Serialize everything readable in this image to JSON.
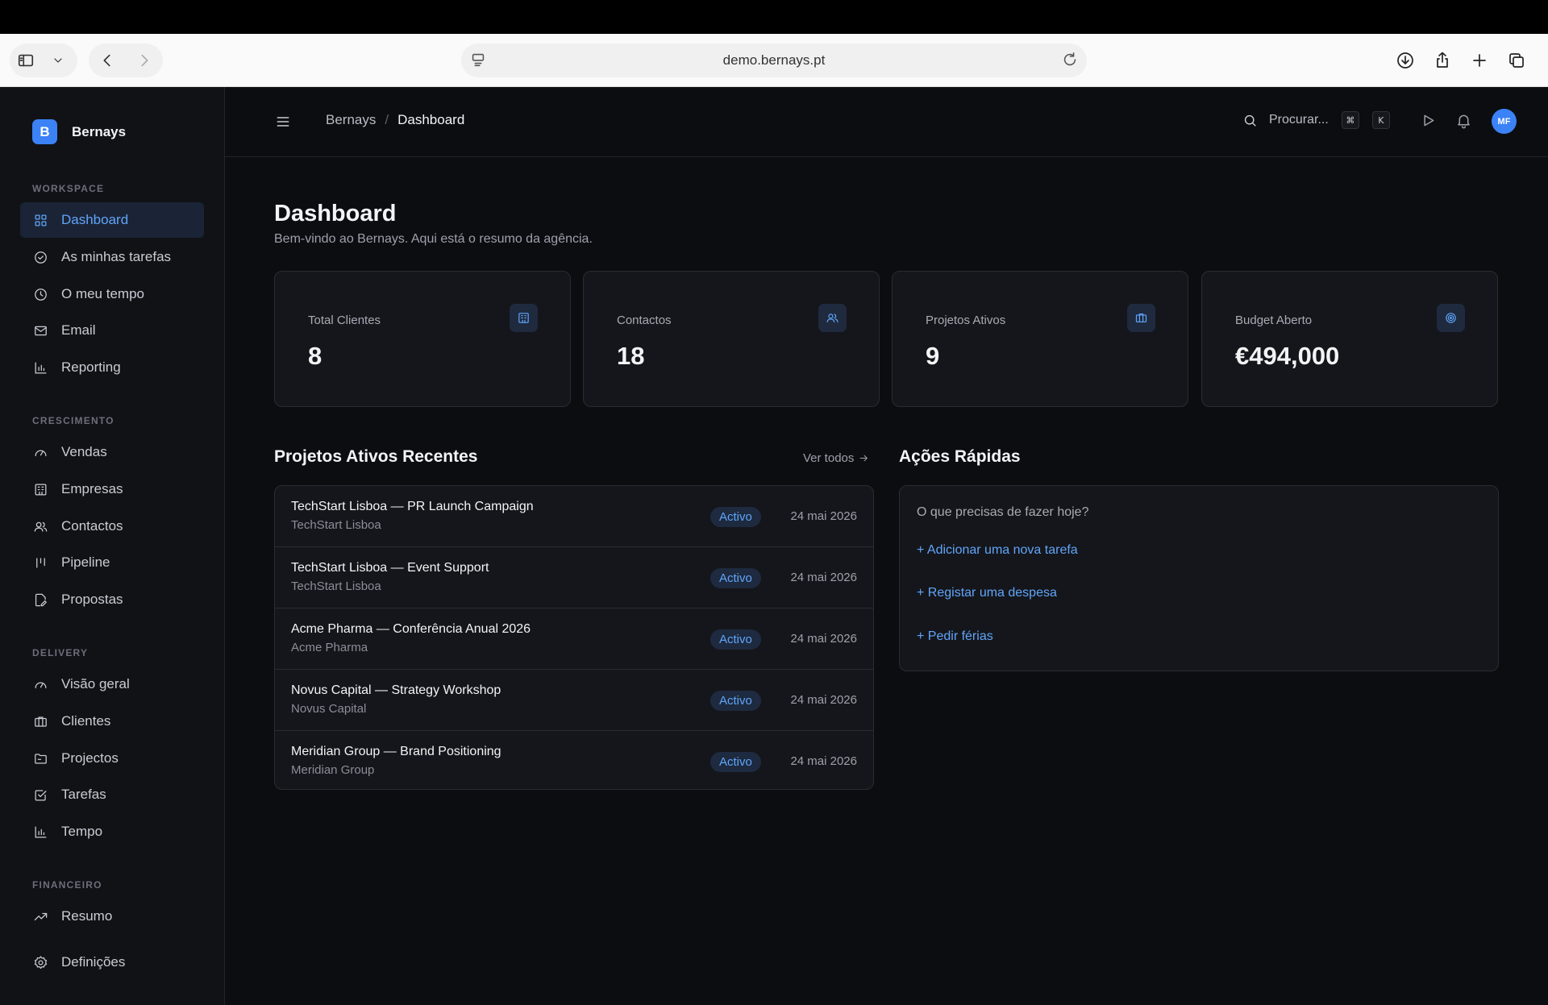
{
  "browser": {
    "url": "demo.bernays.pt"
  },
  "brand": {
    "logo_letter": "B",
    "name": "Bernays"
  },
  "sidebar": {
    "sections": [
      {
        "label": "WORKSPACE",
        "items": [
          {
            "label": "Dashboard",
            "icon": "grid-icon",
            "active": true
          },
          {
            "label": "As minhas tarefas",
            "icon": "check-circle-icon"
          },
          {
            "label": "O meu tempo",
            "icon": "clock-icon"
          },
          {
            "label": "Email",
            "icon": "mail-icon"
          },
          {
            "label": "Reporting",
            "icon": "bar-chart-icon"
          }
        ]
      },
      {
        "label": "CRESCIMENTO",
        "items": [
          {
            "label": "Vendas",
            "icon": "gauge-icon"
          },
          {
            "label": "Empresas",
            "icon": "building-icon"
          },
          {
            "label": "Contactos",
            "icon": "users-icon"
          },
          {
            "label": "Pipeline",
            "icon": "pipeline-icon"
          },
          {
            "label": "Propostas",
            "icon": "file-edit-icon"
          }
        ]
      },
      {
        "label": "DELIVERY",
        "items": [
          {
            "label": "Visão geral",
            "icon": "gauge-icon"
          },
          {
            "label": "Clientes",
            "icon": "briefcase-icon"
          },
          {
            "label": "Projectos",
            "icon": "folder-icon"
          },
          {
            "label": "Tarefas",
            "icon": "checkbox-icon"
          },
          {
            "label": "Tempo",
            "icon": "bar-chart-icon"
          }
        ]
      },
      {
        "label": "FINANCEIRO",
        "items": [
          {
            "label": "Resumo",
            "icon": "trend-up-icon"
          }
        ]
      }
    ],
    "settings_label": "Definições"
  },
  "header": {
    "breadcrumb_root": "Bernays",
    "breadcrumb_separator": "/",
    "breadcrumb_current": "Dashboard",
    "search_placeholder": "Procurar...",
    "shortcut_mod": "⌘",
    "shortcut_key": "K",
    "avatar_initials": "MF"
  },
  "page": {
    "title": "Dashboard",
    "subtitle": "Bem-vindo ao Bernays. Aqui está o resumo da agência."
  },
  "stats": [
    {
      "label": "Total Clientes",
      "value": "8",
      "icon": "building-icon"
    },
    {
      "label": "Contactos",
      "value": "18",
      "icon": "users-icon"
    },
    {
      "label": "Projetos Ativos",
      "value": "9",
      "icon": "briefcase-icon"
    },
    {
      "label": "Budget Aberto",
      "value": "€494,000",
      "icon": "target-icon"
    }
  ],
  "recent_projects": {
    "title": "Projetos Ativos Recentes",
    "see_all": "Ver todos",
    "rows": [
      {
        "name": "TechStart Lisboa — PR Launch Campaign",
        "client": "TechStart Lisboa",
        "status": "Activo",
        "date": "24 mai 2026"
      },
      {
        "name": "TechStart Lisboa — Event Support",
        "client": "TechStart Lisboa",
        "status": "Activo",
        "date": "24 mai 2026"
      },
      {
        "name": "Acme Pharma — Conferência Anual 2026",
        "client": "Acme Pharma",
        "status": "Activo",
        "date": "24 mai 2026"
      },
      {
        "name": "Novus Capital — Strategy Workshop",
        "client": "Novus Capital",
        "status": "Activo",
        "date": "24 mai 2026"
      },
      {
        "name": "Meridian Group — Brand Positioning",
        "client": "Meridian Group",
        "status": "Activo",
        "date": "24 mai 2026"
      }
    ]
  },
  "quick_actions": {
    "title": "Ações Rápidas",
    "prompt": "O que precisas de fazer hoje?",
    "links": [
      "+ Adicionar uma nova tarefa",
      "+ Registar uma despesa",
      "+ Pedir férias"
    ]
  },
  "colors": {
    "accent": "#3b82f6",
    "accent_text": "#60a5fa",
    "background": "#0c0d11",
    "sidebar": "#111216",
    "card": "#15161b"
  }
}
